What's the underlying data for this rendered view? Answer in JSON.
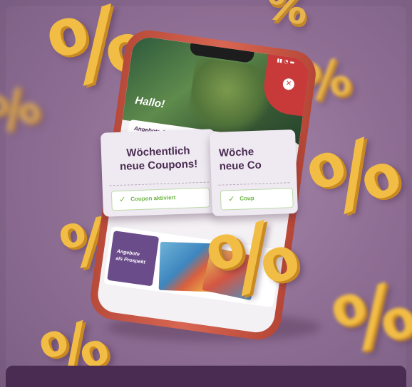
{
  "app": {
    "greeting": "Hallo!",
    "section_title": "Angebote & Coupons",
    "coupons": [
      {
        "title_line1": "Wöchentlich",
        "title_line2": "neue Coupons!",
        "button": "Coupon aktiviert"
      },
      {
        "title_line1": "Wöche",
        "title_line2": "neue Co",
        "button": "Coup"
      }
    ],
    "prospekt_label_line1": "Angebote",
    "prospekt_label_line2": "als Prospekt"
  },
  "decor": {
    "percent_symbol": "%",
    "accent_color": "#f2bd45",
    "phone_color": "#d76652",
    "background_color": "#8e6d93"
  }
}
